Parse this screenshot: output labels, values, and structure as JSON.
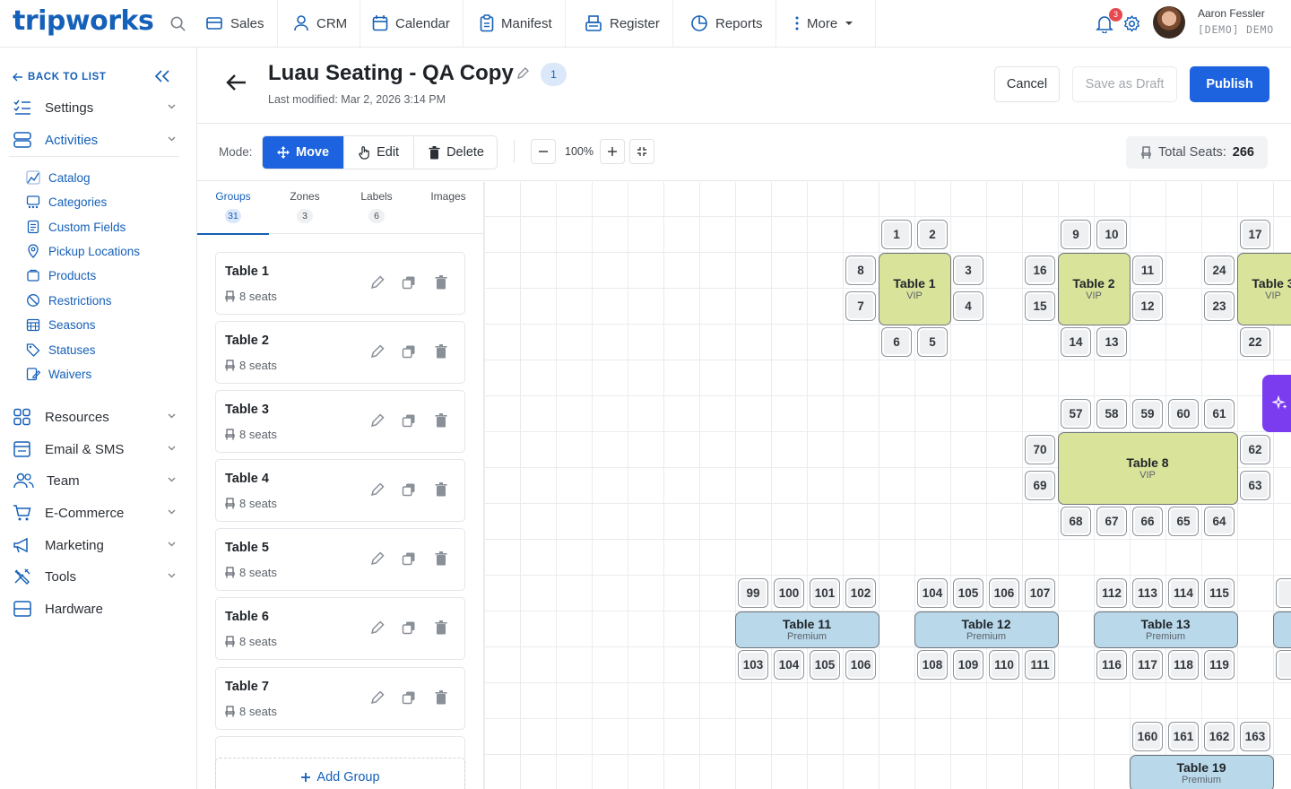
{
  "brand": {
    "logo_text": "tripworks",
    "primary": "#1d63df",
    "link": "#1560b8"
  },
  "topnav": {
    "items": [
      {
        "label": "Sales",
        "icon": "cart-icon"
      },
      {
        "label": "CRM",
        "icon": "person-icon"
      },
      {
        "label": "Calendar",
        "icon": "calendar-icon"
      },
      {
        "label": "Manifest",
        "icon": "clipboard-icon"
      },
      {
        "label": "Register",
        "icon": "register-icon"
      },
      {
        "label": "Reports",
        "icon": "pie-chart-icon"
      },
      {
        "label": "More",
        "icon": "kebab-icon"
      }
    ],
    "notification_count": "3",
    "user_name": "Aaron Fessler",
    "user_role": "[DEMO] DEMO"
  },
  "sidebar": {
    "back_label": "BACK TO LIST",
    "sections": [
      {
        "label": "Settings",
        "icon": "settings-list-icon"
      },
      {
        "label": "Activities",
        "icon": "activities-icon",
        "active": true
      }
    ],
    "activities_items": [
      "Catalog",
      "Categories",
      "Custom Fields",
      "Pickup Locations",
      "Products",
      "Restrictions",
      "Seasons",
      "Statuses",
      "Waivers"
    ],
    "lower_sections": [
      {
        "label": "Resources",
        "icon": "grid-icon"
      },
      {
        "label": "Email & SMS",
        "icon": "email-icon"
      },
      {
        "label": "Team",
        "icon": "team-icon"
      },
      {
        "label": "E-Commerce",
        "icon": "cart-icon"
      },
      {
        "label": "Marketing",
        "icon": "megaphone-icon"
      },
      {
        "label": "Tools",
        "icon": "tools-icon"
      },
      {
        "label": "Hardware",
        "icon": "hardware-icon"
      }
    ]
  },
  "header": {
    "title": "Luau Seating - QA Copy",
    "version": "1",
    "last_modified": "Last modified: Mar 2, 2026 3:14 PM",
    "cancel_label": "Cancel",
    "draft_label": "Save as Draft",
    "publish_label": "Publish"
  },
  "toolbar": {
    "mode_label": "Mode:",
    "modes": [
      "Move",
      "Edit",
      "Delete"
    ],
    "active_mode": "Move",
    "zoom": "100%",
    "total_seats_label": "Total Seats:",
    "total_seats": "266"
  },
  "tabs": [
    {
      "label": "Groups",
      "count": "31",
      "active": true
    },
    {
      "label": "Zones",
      "count": "3"
    },
    {
      "label": "Labels",
      "count": "6"
    },
    {
      "label": "Images",
      "count": ""
    }
  ],
  "groups": [
    {
      "name": "Table 1",
      "seats": "8 seats"
    },
    {
      "name": "Table 2",
      "seats": "8 seats"
    },
    {
      "name": "Table 3",
      "seats": "8 seats"
    },
    {
      "name": "Table 4",
      "seats": "8 seats"
    },
    {
      "name": "Table 5",
      "seats": "8 seats"
    },
    {
      "name": "Table 6",
      "seats": "8 seats"
    },
    {
      "name": "Table 7",
      "seats": "8 seats"
    }
  ],
  "add_group_label": "Add Group",
  "floor": {
    "tables": [
      {
        "name": "Table 1",
        "tier": "VIP"
      },
      {
        "name": "Table 2",
        "tier": "VIP"
      },
      {
        "name": "Table 3",
        "tier": "VIP"
      },
      {
        "name": "Table 8",
        "tier": "VIP"
      },
      {
        "name": "Table 11",
        "tier": "Premium"
      },
      {
        "name": "Table 12",
        "tier": "Premium"
      },
      {
        "name": "Table 13",
        "tier": "Premium"
      },
      {
        "name": "Table 19",
        "tier": "Premium"
      }
    ],
    "tier_colors": {
      "VIP": "#d9e39a",
      "Premium": "#b9d8ea"
    },
    "seats": {
      "table1": [
        "1",
        "2",
        "8",
        "3",
        "7",
        "4",
        "6",
        "5"
      ],
      "table2": [
        "9",
        "10",
        "16",
        "11",
        "15",
        "12",
        "14",
        "13"
      ],
      "table3": [
        "17",
        "24",
        "23",
        "22"
      ],
      "table8": [
        "57",
        "58",
        "59",
        "60",
        "61",
        "70",
        "62",
        "69",
        "63",
        "68",
        "67",
        "66",
        "65",
        "64"
      ],
      "table11": [
        "99",
        "100",
        "101",
        "102",
        "103",
        "104",
        "105",
        "106"
      ],
      "table12": [
        "104",
        "105",
        "106",
        "107",
        "108",
        "109",
        "110",
        "111"
      ],
      "table13": [
        "112",
        "113",
        "114",
        "115",
        "116",
        "117",
        "118",
        "119"
      ],
      "table19": [
        "160",
        "161",
        "162",
        "163"
      ]
    }
  }
}
